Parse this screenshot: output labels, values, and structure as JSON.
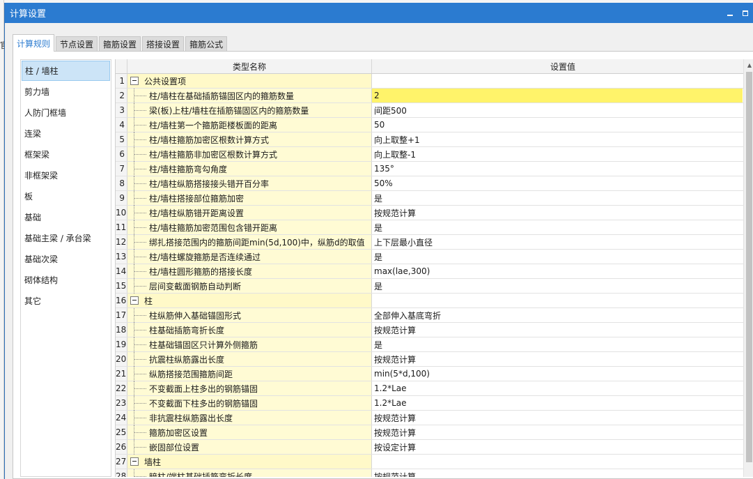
{
  "background": {
    "edge_char": "官"
  },
  "window": {
    "title": "计算设置",
    "minimize_icon": "minimize-icon",
    "maximize_icon": "maximize-icon"
  },
  "tabs": [
    {
      "label": "计算规则",
      "active": true
    },
    {
      "label": "节点设置",
      "active": false
    },
    {
      "label": "箍筋设置",
      "active": false
    },
    {
      "label": "搭接设置",
      "active": false
    },
    {
      "label": "箍筋公式",
      "active": false
    }
  ],
  "sidebar": {
    "selected_index": 0,
    "items": [
      {
        "label": "柱 / 墙柱"
      },
      {
        "label": "剪力墙"
      },
      {
        "label": "人防门框墙"
      },
      {
        "label": "连梁"
      },
      {
        "label": "框架梁"
      },
      {
        "label": "非框架梁"
      },
      {
        "label": "板"
      },
      {
        "label": "基础"
      },
      {
        "label": "基础主梁 / 承台梁"
      },
      {
        "label": "基础次梁"
      },
      {
        "label": "砌体结构"
      },
      {
        "label": "其它"
      }
    ]
  },
  "table": {
    "columns": [
      "类型名称",
      "设置值"
    ],
    "highlight_color": "#fff36a",
    "rows": [
      {
        "num": "1",
        "group": true,
        "name": "公共设置项",
        "value": ""
      },
      {
        "num": "2",
        "group": false,
        "name": "柱/墙柱在基础插筋锚固区内的箍筋数量",
        "value": "2",
        "highlight": true
      },
      {
        "num": "3",
        "group": false,
        "name": "梁(板)上柱/墙柱在插筋锚固区内的箍筋数量",
        "value": "间距500"
      },
      {
        "num": "4",
        "group": false,
        "name": "柱/墙柱第一个箍筋距楼板面的距离",
        "value": "50"
      },
      {
        "num": "5",
        "group": false,
        "name": "柱/墙柱箍筋加密区根数计算方式",
        "value": "向上取整+1"
      },
      {
        "num": "6",
        "group": false,
        "name": "柱/墙柱箍筋非加密区根数计算方式",
        "value": "向上取整-1"
      },
      {
        "num": "7",
        "group": false,
        "name": "柱/墙柱箍筋弯勾角度",
        "value": "135°"
      },
      {
        "num": "8",
        "group": false,
        "name": "柱/墙柱纵筋搭接接头错开百分率",
        "value": "50%"
      },
      {
        "num": "9",
        "group": false,
        "name": "柱/墙柱搭接部位箍筋加密",
        "value": "是"
      },
      {
        "num": "10",
        "group": false,
        "name": "柱/墙柱纵筋错开距离设置",
        "value": "按规范计算"
      },
      {
        "num": "11",
        "group": false,
        "name": "柱/墙柱箍筋加密范围包含错开距离",
        "value": "是"
      },
      {
        "num": "12",
        "group": false,
        "name": "绑扎搭接范围内的箍筋间距min(5d,100)中，纵筋d的取值",
        "value": "上下层最小直径"
      },
      {
        "num": "13",
        "group": false,
        "name": "柱/墙柱螺旋箍筋是否连续通过",
        "value": "是"
      },
      {
        "num": "14",
        "group": false,
        "name": "柱/墙柱圆形箍筋的搭接长度",
        "value": "max(lae,300)"
      },
      {
        "num": "15",
        "group": false,
        "name": "层间变截面钢筋自动判断",
        "value": "是"
      },
      {
        "num": "16",
        "group": true,
        "name": "柱",
        "value": ""
      },
      {
        "num": "17",
        "group": false,
        "name": "柱纵筋伸入基础锚固形式",
        "value": "全部伸入基底弯折"
      },
      {
        "num": "18",
        "group": false,
        "name": "柱基础插筋弯折长度",
        "value": "按规范计算"
      },
      {
        "num": "19",
        "group": false,
        "name": "柱基础锚固区只计算外侧箍筋",
        "value": "是"
      },
      {
        "num": "20",
        "group": false,
        "name": "抗震柱纵筋露出长度",
        "value": "按规范计算"
      },
      {
        "num": "21",
        "group": false,
        "name": "纵筋搭接范围箍筋间距",
        "value": "min(5*d,100)"
      },
      {
        "num": "22",
        "group": false,
        "name": "不变截面上柱多出的钢筋锚固",
        "value": "1.2*Lae"
      },
      {
        "num": "23",
        "group": false,
        "name": "不变截面下柱多出的钢筋锚固",
        "value": "1.2*Lae"
      },
      {
        "num": "24",
        "group": false,
        "name": "非抗震柱纵筋露出长度",
        "value": "按规范计算"
      },
      {
        "num": "25",
        "group": false,
        "name": "箍筋加密区设置",
        "value": "按规范计算"
      },
      {
        "num": "26",
        "group": false,
        "name": "嵌固部位设置",
        "value": "按设定计算"
      },
      {
        "num": "27",
        "group": true,
        "name": "墙柱",
        "value": ""
      },
      {
        "num": "28",
        "group": false,
        "name": "暗柱/端柱基础插筋弯折长度",
        "value": "按规范计算"
      }
    ]
  }
}
